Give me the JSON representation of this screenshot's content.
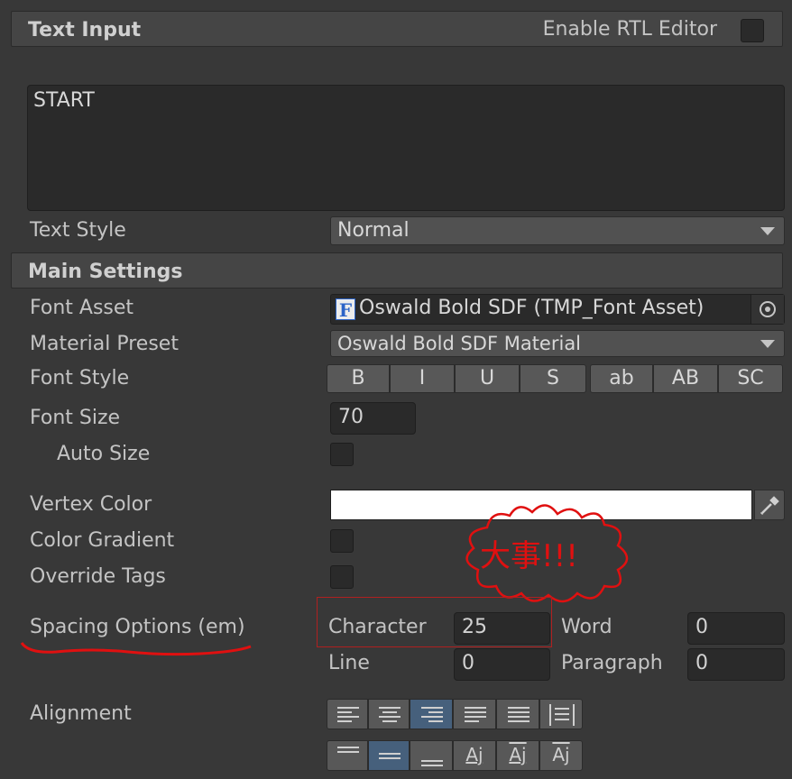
{
  "text_input": {
    "header": "Text Input",
    "rtl_label": "Enable RTL Editor",
    "value": "START",
    "text_style_label": "Text Style",
    "text_style_value": "Normal"
  },
  "main_settings": {
    "header": "Main Settings",
    "font_asset_label": "Font Asset",
    "font_asset_icon": "F",
    "font_asset_value": "Oswald Bold SDF (TMP_Font Asset)",
    "material_preset_label": "Material Preset",
    "material_preset_value": "Oswald Bold SDF Material",
    "font_style_label": "Font Style",
    "font_style_buttons": [
      "B",
      "I",
      "U",
      "S",
      "ab",
      "AB",
      "SC"
    ],
    "font_size_label": "Font Size",
    "font_size_value": "70",
    "auto_size_label": "Auto Size",
    "vertex_color_label": "Vertex Color",
    "vertex_color_value": "#ffffff",
    "color_gradient_label": "Color Gradient",
    "override_tags_label": "Override Tags",
    "spacing_label": "Spacing Options (em)",
    "spacing": {
      "character_label": "Character",
      "character_value": "25",
      "word_label": "Word",
      "word_value": "0",
      "line_label": "Line",
      "line_value": "0",
      "paragraph_label": "Paragraph",
      "paragraph_value": "0"
    },
    "alignment_label": "Alignment"
  },
  "annotation": {
    "text": "大事!!!",
    "color": "#e01010"
  },
  "colors": {
    "background": "#383838",
    "accent_active": "#46607c"
  }
}
